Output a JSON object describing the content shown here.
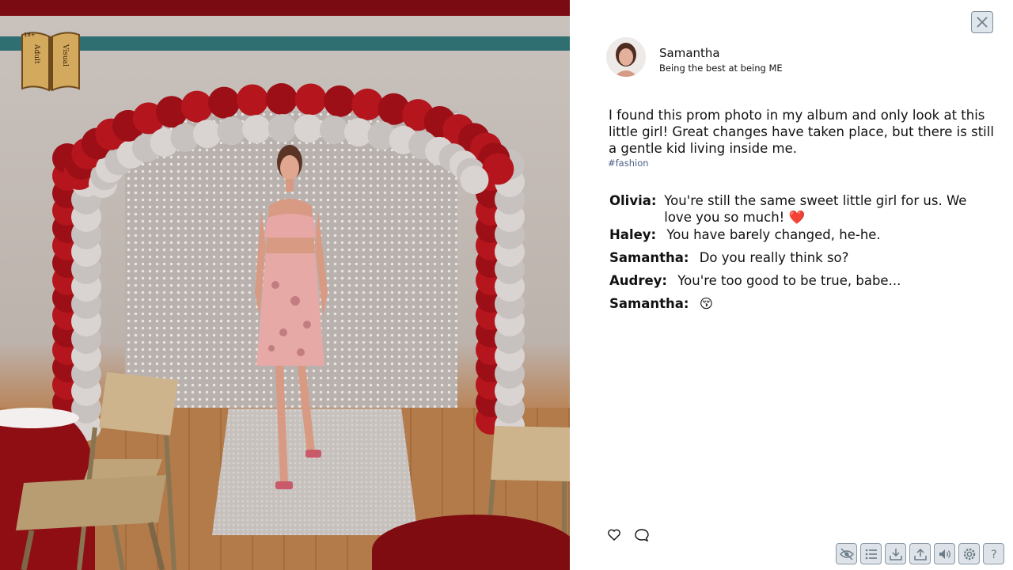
{
  "post": {
    "author": {
      "name": "Samantha",
      "bio": "Being the best at being ME"
    },
    "caption": "I found this prom photo in my album and only look at this little girl! Great changes have taken place, but there is still a gentle kid living inside me.",
    "hashtag": "#fashion",
    "comments": [
      {
        "author": "Olivia:",
        "text": "You're still the same sweet little girl for us. We love you so much! ❤️"
      },
      {
        "author": "Haley:",
        "text": "You have barely changed, he-he."
      },
      {
        "author": "Samantha:",
        "text": "Do you really think so?"
      },
      {
        "author": "Audrey:",
        "text": "You're too good to be true, babe..."
      },
      {
        "author": "Samantha:",
        "text": "😚"
      }
    ]
  },
  "logo": {
    "text_top": "18+",
    "text_left": "Adult",
    "text_right": "Visual"
  },
  "icons": {
    "close": "close-icon",
    "like": "heart-icon",
    "comment": "comment-icon",
    "toolbar": [
      "hide-ui-icon",
      "history-icon",
      "save-icon",
      "load-icon",
      "volume-icon",
      "settings-icon",
      "help-icon"
    ]
  },
  "colors": {
    "accent_red": "#8b0d14",
    "hashtag": "#4a5f86",
    "toolbar_bg": "#dde3e8"
  }
}
